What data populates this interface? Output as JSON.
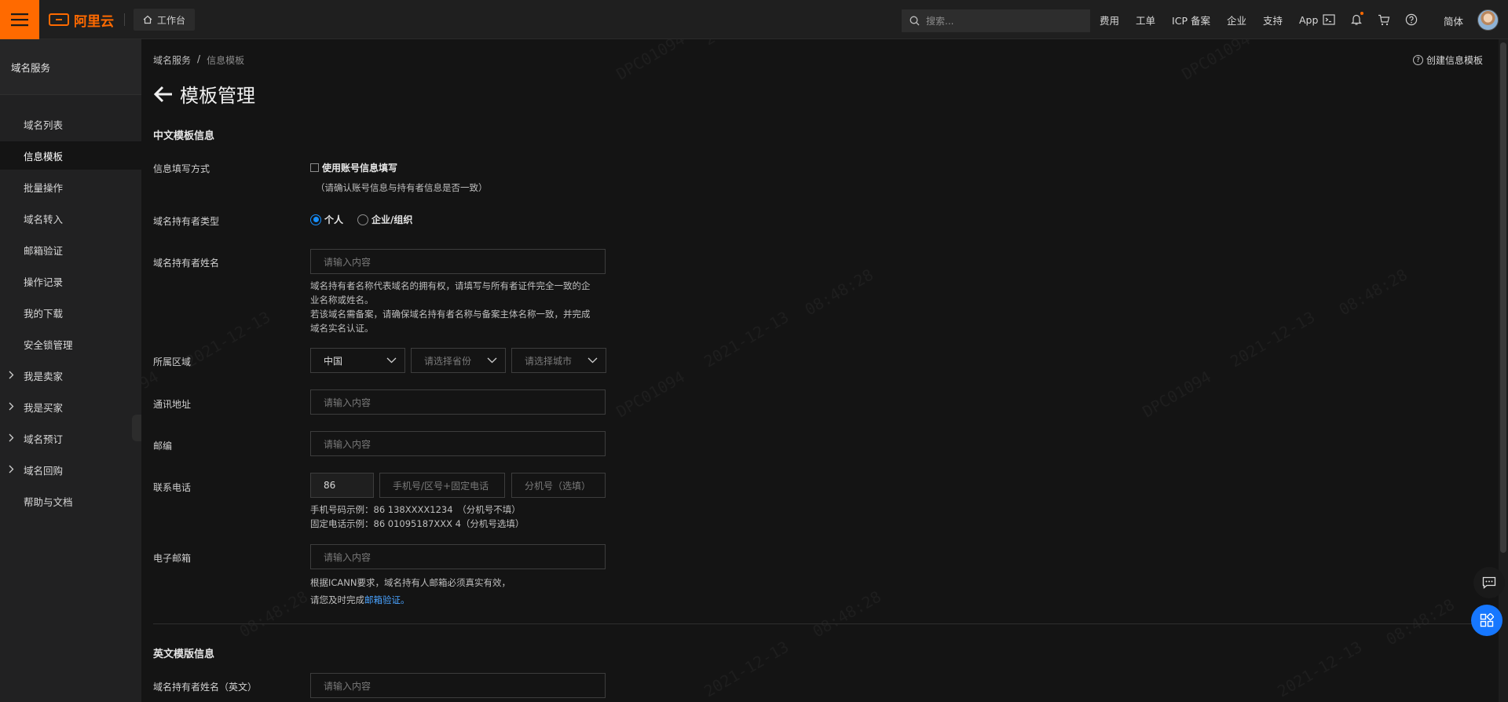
{
  "topbar": {
    "brand": "阿里云",
    "workbench": "工作台",
    "search_placeholder": "搜索...",
    "links": [
      "费用",
      "工单",
      "ICP 备案",
      "企业",
      "支持",
      "App"
    ],
    "language": "简体",
    "accent_color": "#ff6a00"
  },
  "sidebar": {
    "title": "域名服务",
    "items": [
      {
        "label": "域名列表",
        "active": false,
        "expandable": false
      },
      {
        "label": "信息模板",
        "active": true,
        "expandable": false
      },
      {
        "label": "批量操作",
        "active": false,
        "expandable": false
      },
      {
        "label": "域名转入",
        "active": false,
        "expandable": false
      },
      {
        "label": "邮箱验证",
        "active": false,
        "expandable": false
      },
      {
        "label": "操作记录",
        "active": false,
        "expandable": false
      },
      {
        "label": "我的下载",
        "active": false,
        "expandable": false
      },
      {
        "label": "安全锁管理",
        "active": false,
        "expandable": false
      },
      {
        "label": "我是卖家",
        "active": false,
        "expandable": true
      },
      {
        "label": "我是买家",
        "active": false,
        "expandable": true
      },
      {
        "label": "域名预订",
        "active": false,
        "expandable": true
      },
      {
        "label": "域名回购",
        "active": false,
        "expandable": true
      },
      {
        "label": "帮助与文档",
        "active": false,
        "expandable": false
      }
    ]
  },
  "breadcrumb": {
    "root": "域名服务",
    "sep": "/",
    "current": "信息模板"
  },
  "create_link": "创建信息模板",
  "page_title": "模板管理",
  "cn_section": {
    "title": "中文模板信息",
    "fill_method": {
      "label": "信息填写方式",
      "checkbox": "使用账号信息填写",
      "note": "（请确认账号信息与持有者信息是否一致）"
    },
    "owner_type": {
      "label": "域名持有者类型",
      "options": [
        "个人",
        "企业/组织"
      ],
      "selected": "个人"
    },
    "owner_name": {
      "label": "域名持有者姓名",
      "placeholder": "请输入内容",
      "help": [
        "域名持有者名称代表域名的拥有权，请填写与所有者证件完全一致的企",
        "业名称或姓名。",
        "若该域名需备案，请确保域名持有者名称与备案主体名称一致，并完成",
        "域名实名认证。"
      ]
    },
    "region": {
      "label": "所属区域",
      "country": "中国",
      "province_placeholder": "请选择省份",
      "city_placeholder": "请选择城市"
    },
    "address": {
      "label": "通讯地址",
      "placeholder": "请输入内容"
    },
    "postcode": {
      "label": "邮编",
      "placeholder": "请输入内容"
    },
    "phone": {
      "label": "联系电话",
      "country_code": "86",
      "number_placeholder": "手机号/区号+固定电话",
      "ext_placeholder": "分机号（选填）",
      "help": [
        "手机号码示例：86 138XXXX1234　（分机号不填）",
        "固定电话示例：86 01095187XXX 4（分机号选填）"
      ]
    },
    "email": {
      "label": "电子邮箱",
      "placeholder": "请输入内容",
      "help_line1": "根据ICANN要求，域名持有人邮箱必须真实有效，",
      "help_line2_prefix": "请您及时完成",
      "help_link": "邮箱验证。"
    }
  },
  "en_section": {
    "title": "英文模版信息",
    "owner_name": {
      "label": "域名持有者姓名（英文）",
      "placeholder": "请输入内容"
    }
  },
  "watermark": {
    "id": "DPC01094",
    "date": "2021-12-13",
    "time": "08:48:28"
  }
}
